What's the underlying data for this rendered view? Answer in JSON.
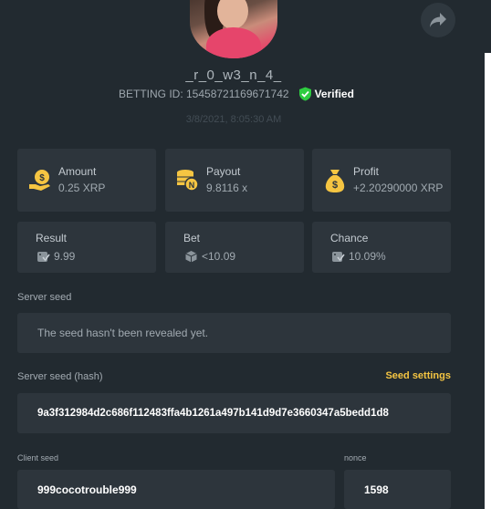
{
  "player": {
    "username": "_r_0_w3_n_4_",
    "betting_id": "BETTING ID: 15458721169671742",
    "verified_label": "Verified",
    "date": "3/8/2021, 8:05:30 AM"
  },
  "stats": {
    "amount": {
      "label": "Amount",
      "value": "0.25 XRP"
    },
    "payout": {
      "label": "Payout",
      "value": "9.8116 x"
    },
    "profit": {
      "label": "Profit",
      "value": "+2.20290000 XRP"
    },
    "result": {
      "label": "Result",
      "value": "9.99"
    },
    "bet": {
      "label": "Bet",
      "value": "<10.09"
    },
    "chance": {
      "label": "Chance",
      "value": "10.09%"
    }
  },
  "seeds": {
    "server_seed_label": "Server seed",
    "server_seed_value": "The seed hasn't been revealed yet.",
    "server_hash_label": "Server seed (hash)",
    "seed_settings_label": "Seed settings",
    "server_hash_value": "9a3f312984d2c686f112483ffa4b1261a497b141d9d7e3660347a5bedd1d8",
    "client_seed_label": "Client seed",
    "client_seed_value": "999cocotrouble999",
    "nonce_label": "nonce",
    "nonce_value": "1598"
  },
  "colors": {
    "background": "#222a30",
    "card": "#2d353c",
    "accent_yellow": "#f5c542",
    "verified_green": "#2ecc40"
  },
  "icons": [
    "share-icon",
    "verified-shield-icon",
    "coin-hand-icon",
    "coin-stack-icon",
    "money-bag-icon",
    "dice-check-icon",
    "dice-icon"
  ]
}
